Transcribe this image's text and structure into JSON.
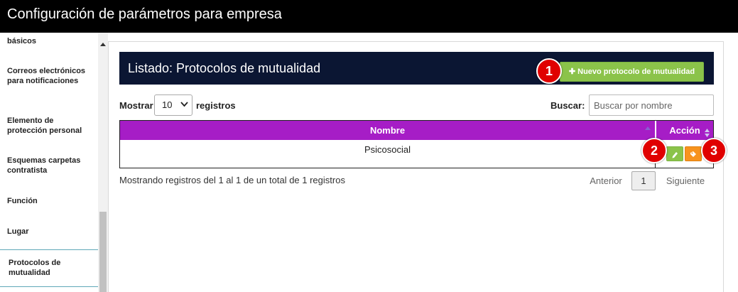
{
  "titlebar": {
    "title": "Configuración de parámetros para empresa"
  },
  "sidebar": {
    "items": [
      {
        "label": "básicos"
      },
      {
        "label": "Correos electrónicos para notificaciones"
      },
      {
        "label": "Elemento de protección personal"
      },
      {
        "label": "Esquemas carpetas contratista"
      },
      {
        "label": "Función"
      },
      {
        "label": "Lugar"
      },
      {
        "label": "Protocolos de mutualidad",
        "active": true
      }
    ]
  },
  "panel": {
    "title": "Listado: Protocolos de mutualidad",
    "new_button_label": "Nuevo protocolo de mutualidad",
    "show_label": "Mostrar",
    "page_size": "10",
    "records_label": "registros",
    "search_label": "Buscar:",
    "search_placeholder": "Buscar por nombre"
  },
  "table": {
    "columns": [
      "Nombre",
      "Acción"
    ],
    "rows": [
      {
        "nombre": "Psicosocial"
      }
    ]
  },
  "footer": {
    "info": "Mostrando registros del 1 al 1 de un total de 1 registros",
    "prev": "Anterior",
    "current_page": "1",
    "next": "Siguiente"
  },
  "callouts": [
    "1",
    "2",
    "3"
  ],
  "colors": {
    "titlebar": "#000000",
    "header": "#0b1633",
    "table_header": "#a61dc6",
    "green_button": "#8bc34a",
    "orange_button": "#f7931e",
    "callout": "#e00000"
  }
}
